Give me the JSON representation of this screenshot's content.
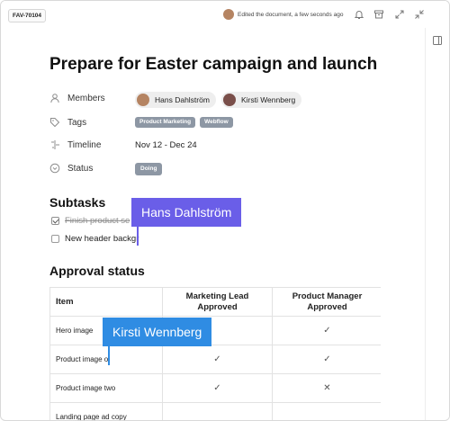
{
  "topbar": {
    "doc_id": "FAV-70104",
    "activity_text": "Edited the document, a few seconds ago",
    "icons": [
      "bell-icon",
      "archive-icon",
      "expand-icon",
      "collapse-icon"
    ]
  },
  "document": {
    "title": "Prepare for Easter campaign and launch",
    "properties": {
      "members_label": "Members",
      "members": [
        "Hans Dahlström",
        "Kirsti Wennberg"
      ],
      "tags_label": "Tags",
      "tags": [
        "Product Marketing",
        "Webflow"
      ],
      "timeline_label": "Timeline",
      "timeline_value": "Nov 12 - Dec 24",
      "status_label": "Status",
      "status_value": "Doing"
    },
    "subtasks_heading": "Subtasks",
    "subtasks": [
      {
        "label": "Finish product se",
        "done": true
      },
      {
        "label": "New header backgr",
        "done": false
      }
    ],
    "approval_heading": "Approval status",
    "approval_table": {
      "headers": [
        "Item",
        "Marketing Lead Approved",
        "Product Manager Approved"
      ],
      "rows": [
        {
          "item": "Hero image",
          "marketing": "",
          "product": "✓"
        },
        {
          "item": "Product image o",
          "marketing": "✓",
          "product": "✓"
        },
        {
          "item": "Product image two",
          "marketing": "✓",
          "product": "✕"
        },
        {
          "item": "Landing page ad copy",
          "marketing": "",
          "product": ""
        }
      ]
    }
  },
  "collaborators": {
    "cursor_1": "Hans Dahlström",
    "cursor_2": "Kirsti Wennberg"
  },
  "colors": {
    "cursor_1": "#6a5ee8",
    "cursor_2": "#2f8ce3",
    "tag_bg": "#8d97a4"
  }
}
